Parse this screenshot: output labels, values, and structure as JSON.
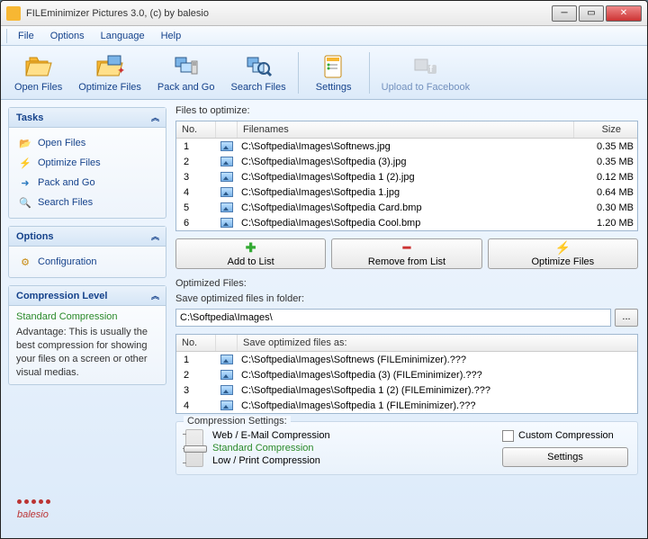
{
  "window": {
    "title": "FILEminimizer Pictures 3.0, (c) by balesio"
  },
  "menu": {
    "file": "File",
    "options": "Options",
    "language": "Language",
    "help": "Help"
  },
  "toolbar": {
    "open": "Open Files",
    "optimize": "Optimize Files",
    "pack": "Pack and Go",
    "search": "Search Files",
    "settings": "Settings",
    "upload": "Upload to Facebook"
  },
  "sidebar": {
    "tasks_hd": "Tasks",
    "tasks": {
      "open": "Open Files",
      "optimize": "Optimize Files",
      "pack": "Pack and Go",
      "search": "Search Files"
    },
    "options_hd": "Options",
    "config": "Configuration",
    "compression_hd": "Compression Level",
    "comp_name": "Standard Compression",
    "comp_adv": "Advantage: This is usually the best compression for showing your files on a screen or other visual medias."
  },
  "main": {
    "files_label": "Files to optimize:",
    "col_no": "No.",
    "col_fn": "Filenames",
    "col_sz": "Size",
    "files": [
      {
        "no": "1",
        "name": "C:\\Softpedia\\Images\\Softnews.jpg",
        "size": "0.35 MB"
      },
      {
        "no": "2",
        "name": "C:\\Softpedia\\Images\\Softpedia (3).jpg",
        "size": "0.35 MB"
      },
      {
        "no": "3",
        "name": "C:\\Softpedia\\Images\\Softpedia 1 (2).jpg",
        "size": "0.12 MB"
      },
      {
        "no": "4",
        "name": "C:\\Softpedia\\Images\\Softpedia 1.jpg",
        "size": "0.64 MB"
      },
      {
        "no": "5",
        "name": "C:\\Softpedia\\Images\\Softpedia Card.bmp",
        "size": "0.30 MB"
      },
      {
        "no": "6",
        "name": "C:\\Softpedia\\Images\\Softpedia Cool.bmp",
        "size": "1.20 MB"
      }
    ],
    "add": "Add to List",
    "remove": "Remove from List",
    "optimize": "Optimize Files",
    "opt_files_label": "Optimized Files:",
    "save_folder_label": "Save optimized files in folder:",
    "save_folder": "C:\\Softpedia\\Images\\",
    "browse": "...",
    "col_save_as": "Save optimized files as:",
    "opt_files": [
      {
        "no": "1",
        "name": "C:\\Softpedia\\Images\\Softnews (FILEminimizer).???"
      },
      {
        "no": "2",
        "name": "C:\\Softpedia\\Images\\Softpedia (3) (FILEminimizer).???"
      },
      {
        "no": "3",
        "name": "C:\\Softpedia\\Images\\Softpedia 1 (2) (FILEminimizer).???"
      },
      {
        "no": "4",
        "name": "C:\\Softpedia\\Images\\Softpedia 1 (FILEminimizer).???"
      }
    ],
    "comp_settings": "Compression Settings:",
    "level_web": "Web / E-Mail Compression",
    "level_std": "Standard Compression",
    "level_low": "Low / Print Compression",
    "custom": "Custom Compression",
    "settings_btn": "Settings"
  },
  "logo": "balesio"
}
